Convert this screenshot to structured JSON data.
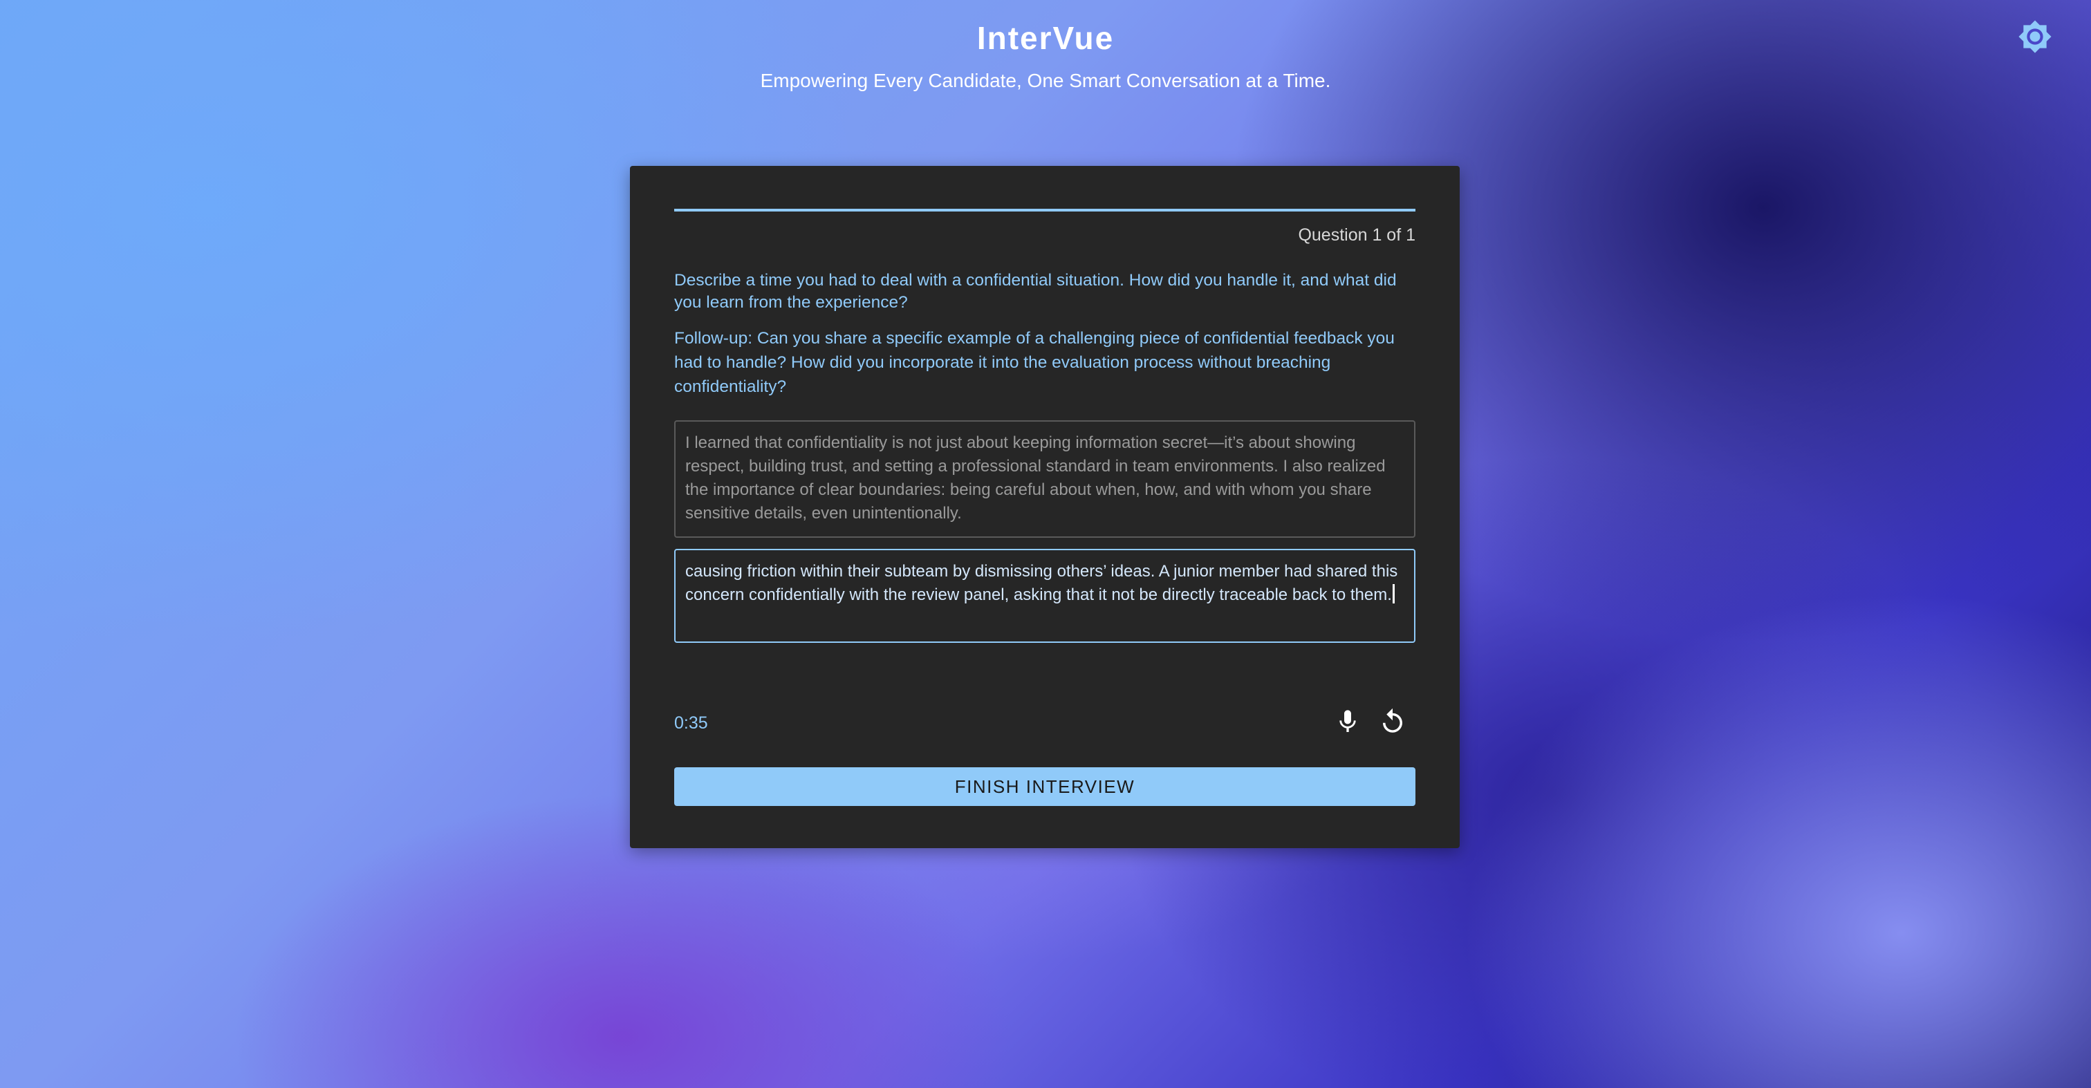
{
  "header": {
    "title": "InterVue",
    "subtitle": "Empowering Every Candidate, One Smart Conversation at a Time.",
    "theme_icon": "brightness-gear-icon"
  },
  "interview": {
    "progress": 1.0,
    "counter": "Question 1 of 1",
    "question": "Describe a time you had to deal with a confidential situation. How did you handle it, and what did you learn from the experience?",
    "followup": "Follow-up: Can you share a specific example of a challenging piece of confidential feedback you had to handle? How did you incorporate it into the evaluation process without breaching confidentiality?",
    "previous_answer": "I learned that confidentiality is not just about keeping information secret—it’s about showing respect, building trust, and setting a professional standard in team environments. I also realized the importance of clear boundaries: being careful about when, how, and with whom you share sensitive details, even unintentionally.",
    "current_answer": "causing friction within their subteam by dismissing others’ ideas. A junior member had shared this concern confidentially with the review panel, asking that it not be directly traceable back to them.",
    "timer": "0:35",
    "finish_label": "FINISH INTERVIEW"
  },
  "colors": {
    "accent": "#90caf9",
    "card_bg": "#262626"
  }
}
